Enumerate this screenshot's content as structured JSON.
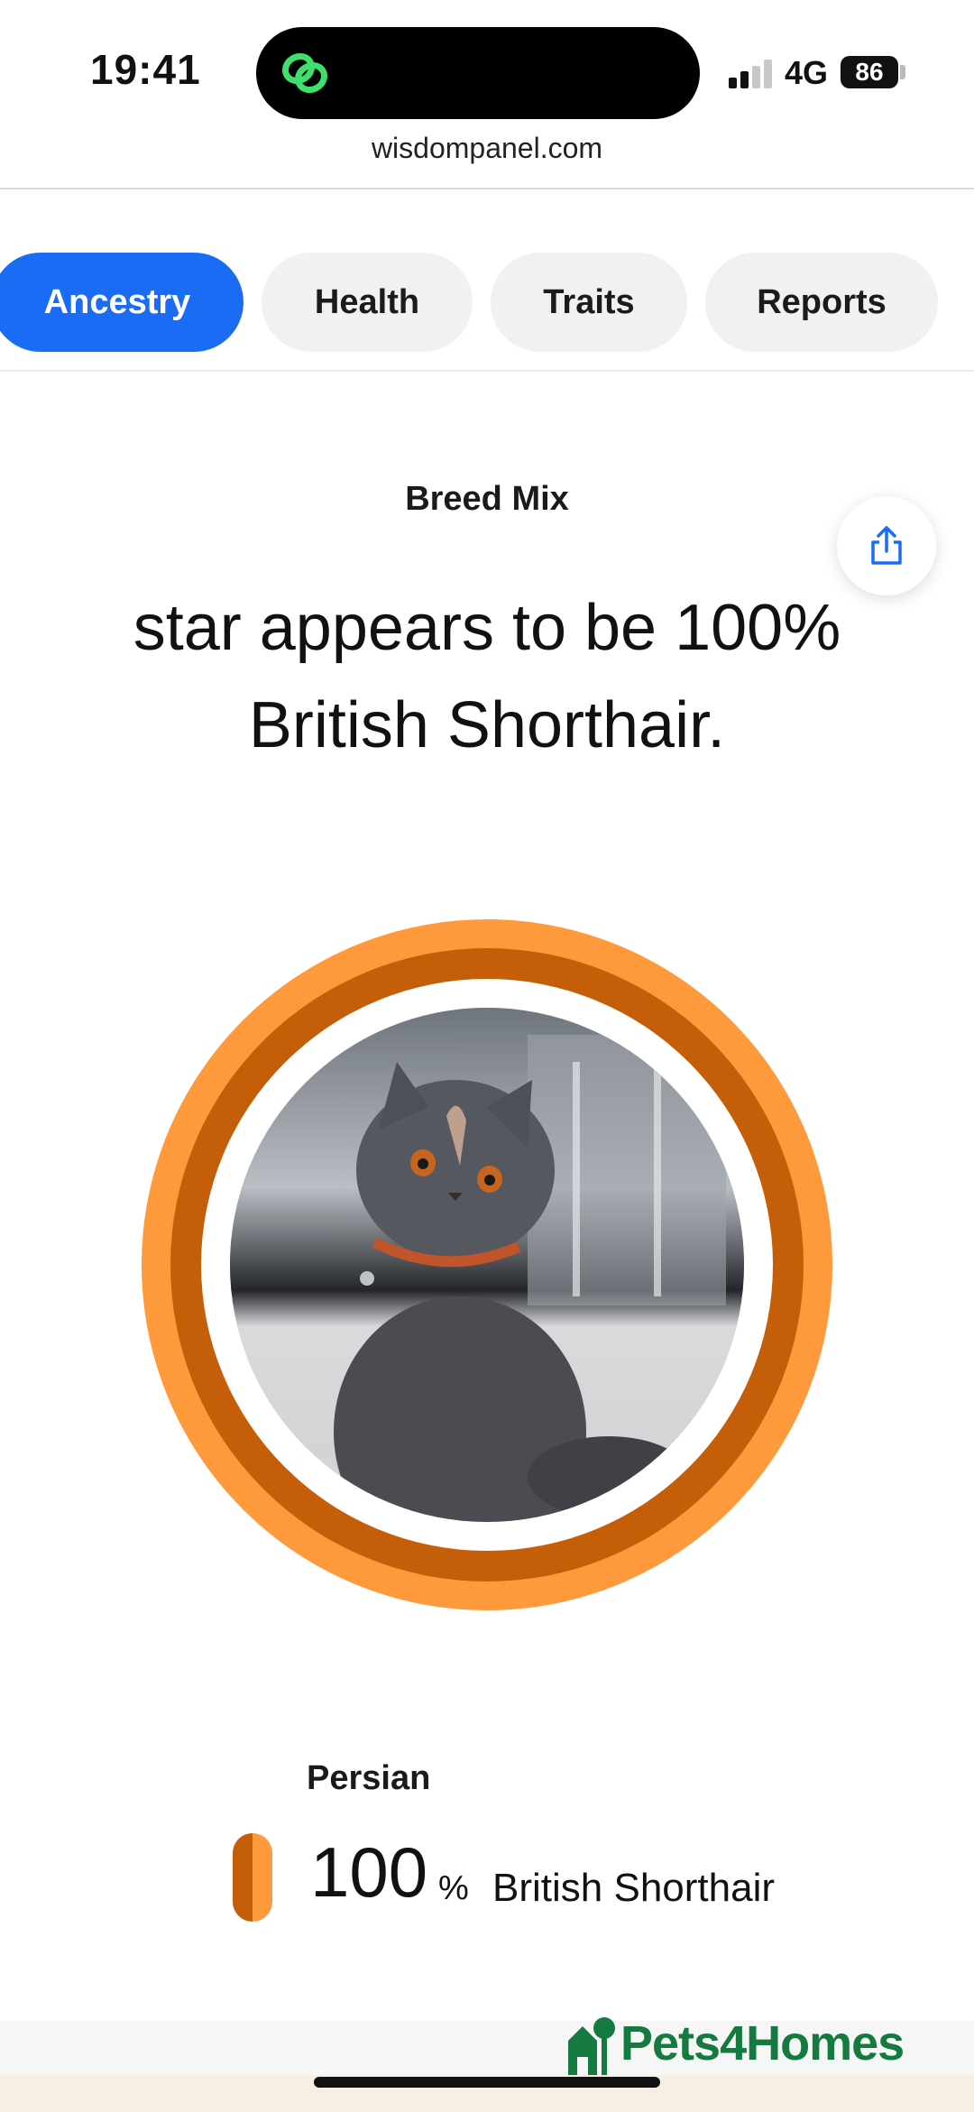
{
  "status_bar": {
    "time": "19:41",
    "network": "4G",
    "battery": "86",
    "island_app_icon": "link-chain-icon"
  },
  "browser": {
    "url": "wisdompanel.com"
  },
  "tabs": [
    {
      "label": "Ancestry",
      "active": true
    },
    {
      "label": "Health",
      "active": false
    },
    {
      "label": "Traits",
      "active": false
    },
    {
      "label": "Reports",
      "active": false
    }
  ],
  "section": {
    "label": "Breed Mix",
    "headline": "star appears to be 100% British Shorthair.",
    "share_icon": "share-icon"
  },
  "breakdown": {
    "heading": "Persian",
    "value": "100",
    "unit": "%",
    "name": "British Shorthair",
    "percent": 100
  },
  "colors": {
    "accent_blue": "#1a6cf5",
    "ring_light": "#ff9a3c",
    "ring_dark": "#c45e08",
    "brand_green": "#157a3f"
  },
  "footer": {
    "brand": "Pets4Homes",
    "brand_icon": "house-tree-logo-icon"
  }
}
